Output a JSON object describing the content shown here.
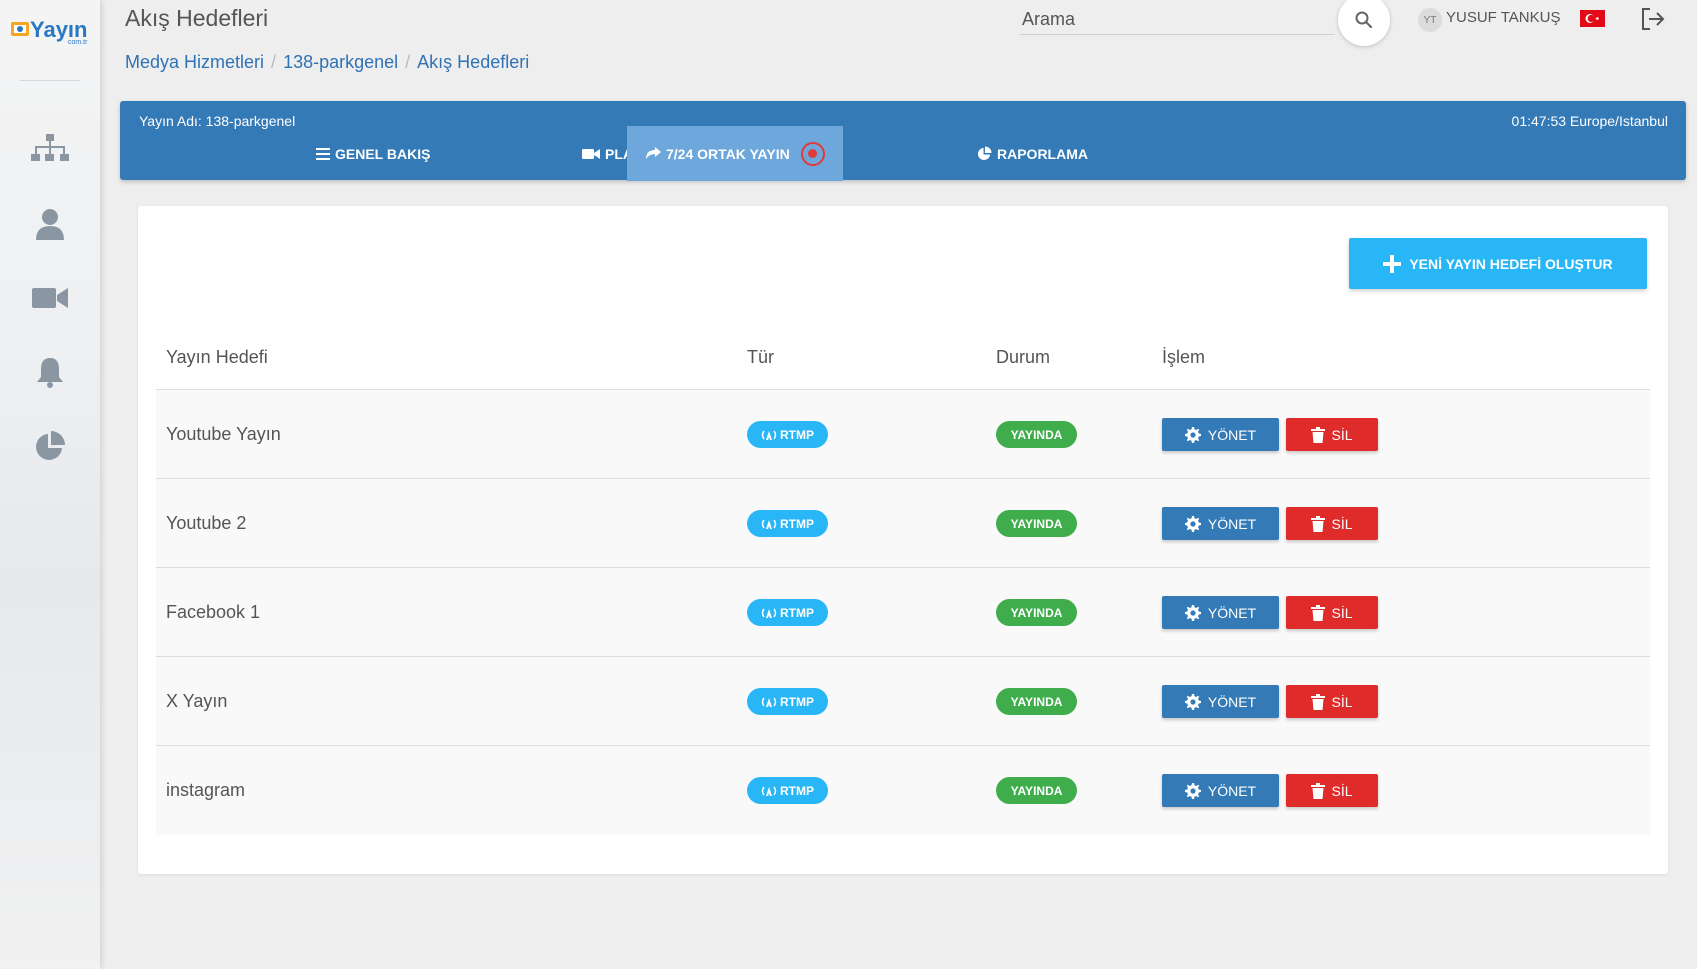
{
  "brand": {
    "logo_text": "Yayın",
    "logo_sub": "com.tr"
  },
  "header": {
    "title": "Akış Hedefleri",
    "breadcrumb": [
      "Medya Hizmetleri",
      "138-parkgenel",
      "Akış Hedefleri"
    ],
    "search_placeholder": "Arama",
    "user_initials": "YT",
    "user_name": "YUSUF TANKUŞ"
  },
  "sidebar": {
    "items": [
      {
        "icon": "sitemap-icon"
      },
      {
        "icon": "user-icon"
      },
      {
        "icon": "video-camera-icon"
      },
      {
        "icon": "bell-icon"
      },
      {
        "icon": "pie-chart-icon"
      }
    ]
  },
  "panel": {
    "stream_label": "Yayın Adı: 138-parkgenel",
    "clock": "01:47:53 Europe/Istanbul",
    "tabs": [
      {
        "label": "GENEL BAKIŞ",
        "icon": "list-icon"
      },
      {
        "label": "PLAYER AYARLARI",
        "icon": "video-icon"
      },
      {
        "label": "7/24 ORTAK YAYIN",
        "icon": "share-icon",
        "active": true
      },
      {
        "label": "RAPORLAMA",
        "icon": "pie-chart-icon"
      }
    ]
  },
  "new_button_label": "YENİ YAYIN HEDEFİ OLUŞTUR",
  "table": {
    "columns": [
      "Yayın Hedefi",
      "Tür",
      "Durum",
      "İşlem"
    ],
    "rows": [
      {
        "name": "Youtube Yayın",
        "type": "RTMP",
        "status": "YAYINDA"
      },
      {
        "name": "Youtube 2",
        "type": "RTMP",
        "status": "YAYINDA"
      },
      {
        "name": "Facebook 1",
        "type": "RTMP",
        "status": "YAYINDA"
      },
      {
        "name": "X Yayın",
        "type": "RTMP",
        "status": "YAYINDA"
      },
      {
        "name": "instagram",
        "type": "RTMP",
        "status": "YAYINDA"
      }
    ],
    "manage_label": "YÖNET",
    "delete_label": "SİL"
  },
  "colors": {
    "primary": "#337ab7",
    "accent": "#29b6f6",
    "success": "#3fad4b",
    "danger": "#e02b2b"
  }
}
